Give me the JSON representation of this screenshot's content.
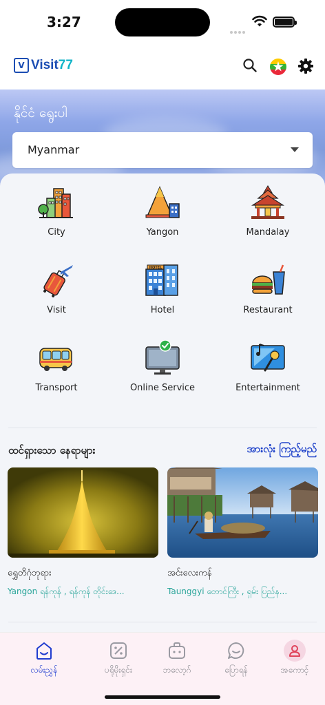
{
  "status_bar": {
    "time": "3:27"
  },
  "header": {
    "brand": "Visit",
    "brand_accent": "77",
    "logo_mark": "V"
  },
  "hero": {
    "title": "နိုင်ငံ ရွေးပါ",
    "country_select": {
      "selected": "Myanmar"
    }
  },
  "categories": [
    {
      "label": "City",
      "icon": "city-icon"
    },
    {
      "label": "Yangon",
      "icon": "pagoda-icon"
    },
    {
      "label": "Mandalay",
      "icon": "palace-icon"
    },
    {
      "label": "Visit",
      "icon": "luggage-icon"
    },
    {
      "label": "Hotel",
      "icon": "hotel-icon"
    },
    {
      "label": "Restaurant",
      "icon": "burger-drink-icon"
    },
    {
      "label": "Transport",
      "icon": "bus-icon"
    },
    {
      "label": "Online Service",
      "icon": "monitor-check-icon"
    },
    {
      "label": "Entertainment",
      "icon": "music-mic-icon"
    }
  ],
  "popular": {
    "title": "ထင်ရှားသော နေရာများ",
    "see_all": "အားလုံး ကြည့်မည်",
    "places": [
      {
        "name": "ရွှေတိဂုံဘုရား",
        "location": "Yangon ရန်ကုန် , ရန်ကုန် တိုင်းဒေ..."
      },
      {
        "name": "အင်းလေးကန်",
        "location": "Taunggyi တောင်ကြီး , ရှမ်း ပြည်န..."
      }
    ]
  },
  "tabbar": {
    "items": [
      {
        "label": "လမ်းညွှန်",
        "active": true
      },
      {
        "label": "ပရိုမိုးရှင်း",
        "active": false
      },
      {
        "label": "ဘလော့ဂ်",
        "active": false
      },
      {
        "label": "ပြောရန်",
        "active": false
      },
      {
        "label": "အကောင့်",
        "active": false
      }
    ]
  },
  "colors": {
    "brand": "#1b4db3",
    "accent": "#10b4c8",
    "link": "#1b3fc9",
    "location": "#2aa59a",
    "tab_active": "#1f3ccf"
  }
}
